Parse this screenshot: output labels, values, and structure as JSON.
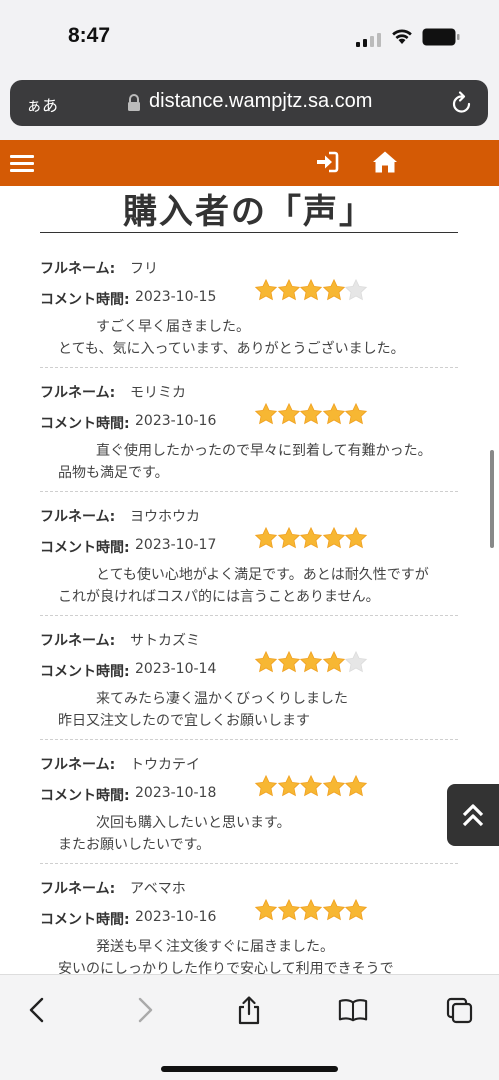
{
  "status_bar": {
    "time": "8:47"
  },
  "address_bar": {
    "aa_label": "ぁあ",
    "url": "distance.wampjtz.sa.com"
  },
  "page": {
    "title": "購入者の「声」"
  },
  "labels": {
    "name": "フルネーム:",
    "time": "コメント時間:"
  },
  "reviews": [
    {
      "name": "フリ",
      "date": "2023-10-15",
      "rating": 4,
      "comment": "すごく早く届きました。\nとても、気に入っています、ありがとうございました。"
    },
    {
      "name": "モリミカ",
      "date": "2023-10-16",
      "rating": 5,
      "comment": "直ぐ使用したかったので早々に到着して有難かった。品物も満足です。"
    },
    {
      "name": "ヨウホウカ",
      "date": "2023-10-17",
      "rating": 5,
      "comment": "とても使い心地がよく満足です。あとは耐久性ですがこれが良ければコスパ的には言うことありません。"
    },
    {
      "name": "サトカズミ",
      "date": "2023-10-14",
      "rating": 4,
      "comment": "来てみたら凄く温かくびっくりしました\n昨日又注文したので宜しくお願いします"
    },
    {
      "name": "トウカテイ",
      "date": "2023-10-18",
      "rating": 5,
      "comment": "次回も購入したいと思います。\nまたお願いしたいです。"
    },
    {
      "name": "アベマホ",
      "date": "2023-10-16",
      "rating": 5,
      "comment": "発送も早く注文後すぐに届きました。\n安いのにしっかりした作りで安心して利用できそうで"
    }
  ],
  "colors": {
    "header": "#d45a05",
    "star_filled": "#f7b733",
    "star_empty": "#e6e6e6"
  },
  "icons": {
    "menu": "hamburger-icon",
    "login": "sign-in-icon",
    "home": "home-icon",
    "top": "double-chevron-up-icon"
  }
}
